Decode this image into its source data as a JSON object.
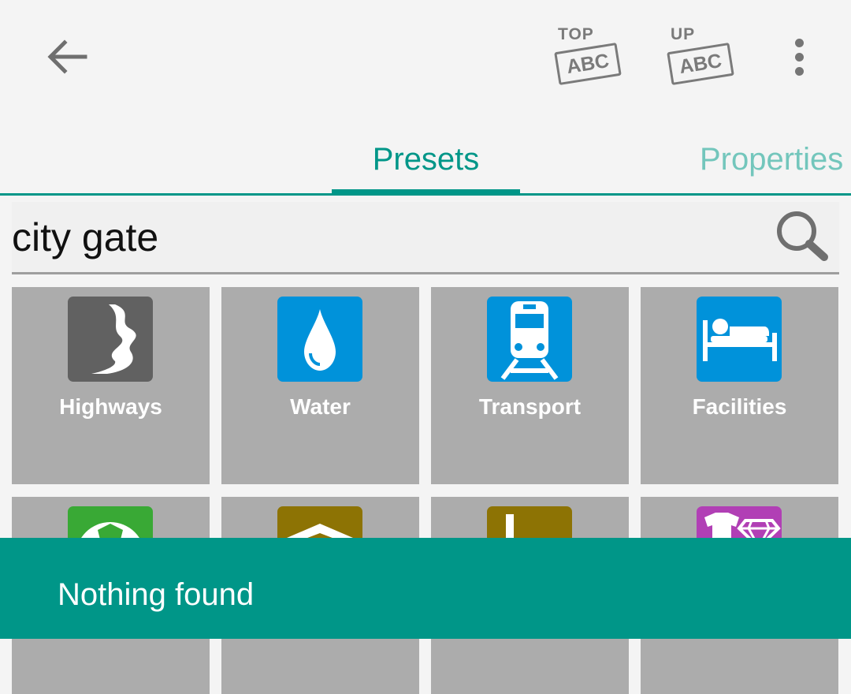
{
  "toolbar": {
    "back_icon": "arrow-left-icon",
    "top_abc": {
      "small": "TOP",
      "box": "ABC"
    },
    "up_abc": {
      "small": "UP",
      "box": "ABC"
    },
    "overflow_icon": "more-vert-icon"
  },
  "tabs": [
    {
      "label": "Presets",
      "selected": true
    },
    {
      "label": "Properties",
      "selected": false
    }
  ],
  "search": {
    "value": "city gate",
    "icon": "search-icon"
  },
  "presets": [
    {
      "label": "Highways",
      "icon": "highway-icon",
      "color": "#616161"
    },
    {
      "label": "Water",
      "icon": "water-drop-icon",
      "color": "#0092da"
    },
    {
      "label": "Transport",
      "icon": "train-icon",
      "color": "#0092da"
    },
    {
      "label": "Facilities",
      "icon": "bed-icon",
      "color": "#0092da"
    },
    {
      "label": "",
      "icon": "sports-ball-icon",
      "color": "#39a935"
    },
    {
      "label": "",
      "icon": "building-roof-icon",
      "color": "#8d7304"
    },
    {
      "label": "",
      "icon": "landuse-icon",
      "color": "#8d7304"
    },
    {
      "label": "",
      "icon": "shop-icon",
      "color": "#b13fb5"
    }
  ],
  "snackbar": {
    "message": "Nothing found"
  },
  "colors": {
    "accent": "#009688",
    "tile_background": "#acacac",
    "background": "#f4f4f4"
  }
}
